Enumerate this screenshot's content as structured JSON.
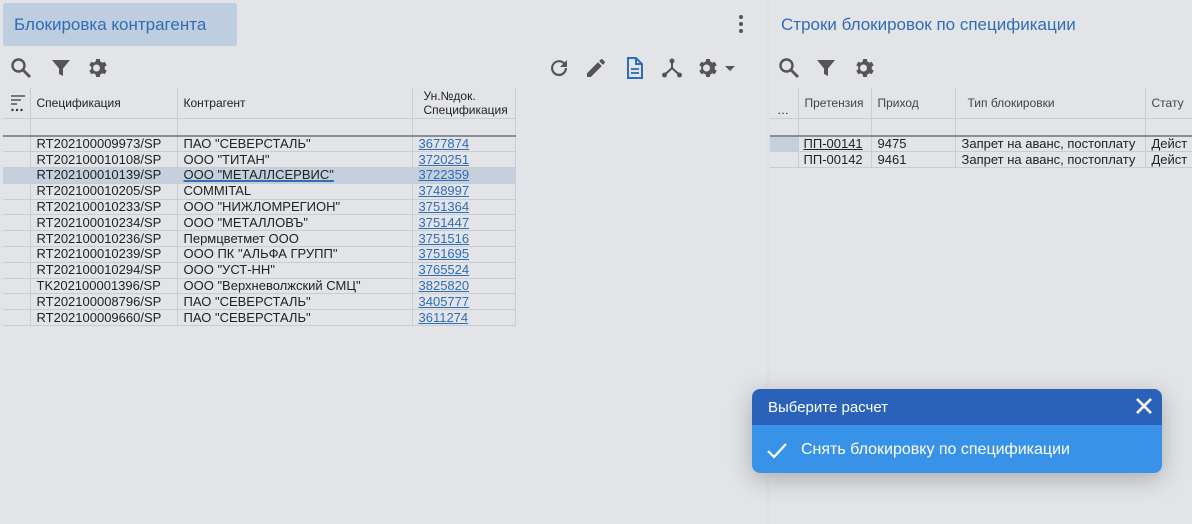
{
  "left_panel": {
    "title": "Блокировка контрагента",
    "columns": [
      "Спецификация",
      "Контрагент",
      "Ун.№док.",
      "Спецификация"
    ],
    "rows": [
      {
        "spec": "RT202100009973/SP",
        "counterparty": "ПАО \"СЕВЕРСТАЛЬ\"",
        "doc": "3677874"
      },
      {
        "spec": "RT202100010108/SP",
        "counterparty": "ООО \"ТИТАН\"",
        "doc": "3720251"
      },
      {
        "spec": "RT202100010139/SP",
        "counterparty": "ООО \"МЕТАЛЛСЕРВИС\"",
        "doc": "3722359"
      },
      {
        "spec": "RT202100010205/SP",
        "counterparty": "COMMITAL",
        "doc": "3748997"
      },
      {
        "spec": "RT202100010233/SP",
        "counterparty": "ООО \"НИЖЛОМРЕГИОН\"",
        "doc": "3751364"
      },
      {
        "spec": "RT202100010234/SP",
        "counterparty": "ООО \"МЕТАЛЛОВЪ\"",
        "doc": "3751447"
      },
      {
        "spec": "RT202100010236/SP",
        "counterparty": "Пермцветмет ООО",
        "doc": "3751516"
      },
      {
        "spec": "RT202100010239/SP",
        "counterparty": "ООО ПК \"АЛЬФА ГРУПП\"",
        "doc": "3751695"
      },
      {
        "spec": "RT202100010294/SP",
        "counterparty": "ООО \"УСТ-НН\"",
        "doc": "3765524"
      },
      {
        "spec": "TK202100001396/SP",
        "counterparty": "ООО \"Верхневолжский СМЦ\"",
        "doc": "3825820"
      },
      {
        "spec": "RT202100008796/SP",
        "counterparty": "ПАО \"СЕВЕРСТАЛЬ\"",
        "doc": "3405777"
      },
      {
        "spec": "RT202100009660/SP",
        "counterparty": "ПАО \"СЕВЕРСТАЛЬ\"",
        "doc": "3611274"
      }
    ],
    "selected_row": 2
  },
  "right_panel": {
    "title": "Строки блокировок по спецификации",
    "columns": [
      "Претензия",
      "Приход",
      "Тип блокировки",
      "Стату"
    ],
    "rows": [
      {
        "claim": "ПП-00141",
        "income": "9475",
        "type": "Запрет на аванс, постоплату",
        "status": "Дейст"
      },
      {
        "claim": "ПП-00142",
        "income": "9461",
        "type": "Запрет на аванс, постоплату",
        "status": "Дейст"
      }
    ]
  },
  "popup": {
    "title": "Выберите расчет",
    "item": "Снять блокировку по спецификации"
  },
  "colors": {
    "accent": "#2f6db5",
    "popup_header": "#2a62b9",
    "popup_item": "#3893e8",
    "selection": "#c4d0dd"
  },
  "icons": [
    "search-icon",
    "filter-icon",
    "settings-icon",
    "refresh-icon",
    "edit-icon",
    "document-icon",
    "hierarchy-icon",
    "chevron-down-icon",
    "kebab-menu-icon",
    "sort-columns-icon",
    "close-icon",
    "check-icon"
  ]
}
